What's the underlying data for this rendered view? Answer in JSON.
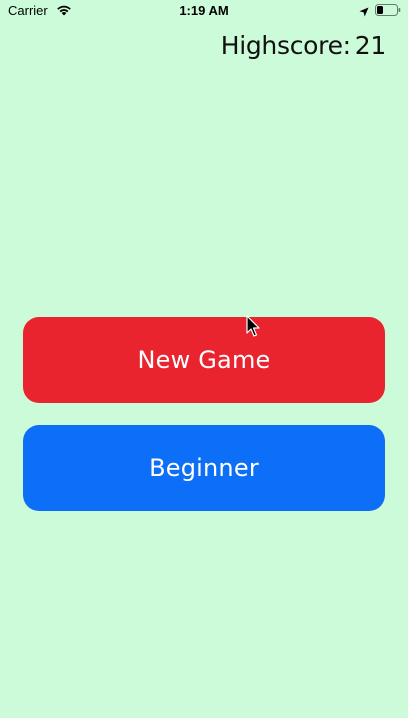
{
  "status_bar": {
    "carrier": "Carrier",
    "time": "1:19 AM",
    "icons": [
      "wifi-icon",
      "location-arrow-icon",
      "battery-icon"
    ]
  },
  "highscore": {
    "label": "Highscore:",
    "value": "21"
  },
  "menu": {
    "new_game_label": "New Game",
    "beginner_label": "Beginner"
  },
  "colors": {
    "background": "#cbfbd9",
    "new_game_button": "#e9242f",
    "beginner_button": "#0d6ff8",
    "button_text": "#ffffff"
  }
}
